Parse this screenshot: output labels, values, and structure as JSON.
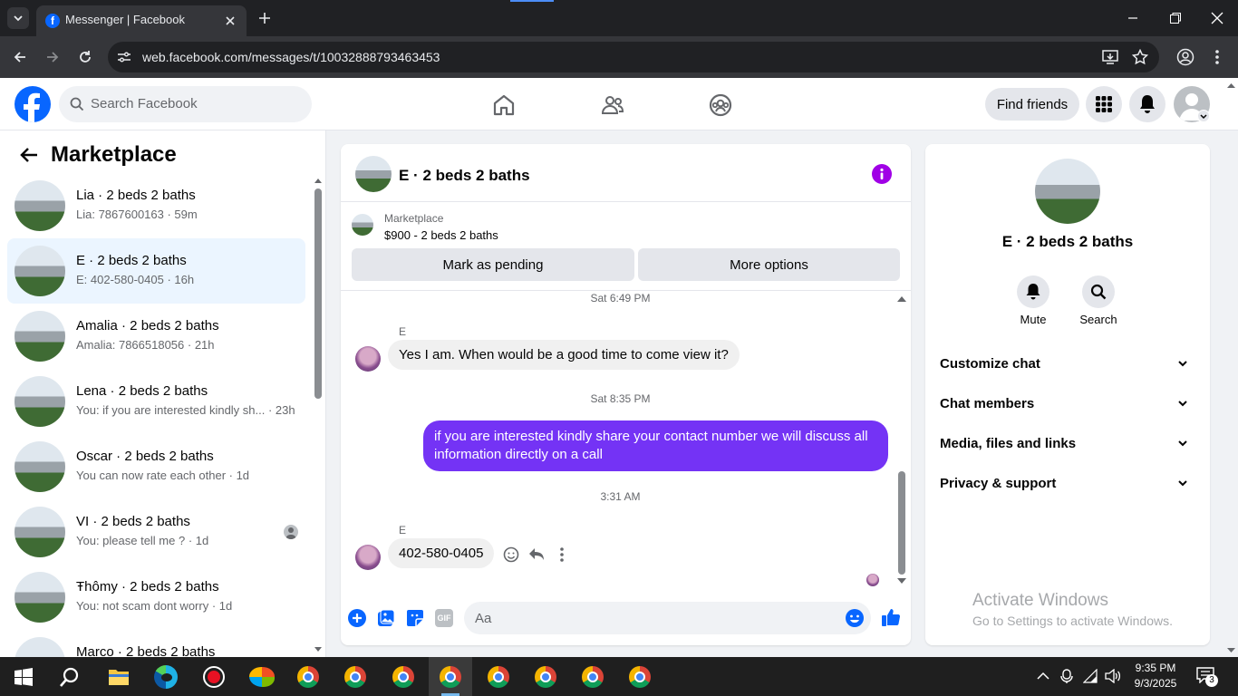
{
  "browser": {
    "tab_title": "Messenger | Facebook",
    "url": "web.facebook.com/messages/t/10032888793463453"
  },
  "fb": {
    "search_placeholder": "Search Facebook",
    "find_friends": "Find friends"
  },
  "left": {
    "title": "Marketplace",
    "conversations": [
      {
        "title": "Lia · 2 beds 2 baths",
        "sub": "Lia: 7867600163 · 59m"
      },
      {
        "title": "E · 2 beds 2 baths",
        "sub": "E: 402-580-0405 · 16h"
      },
      {
        "title": "Amalia · 2 beds 2 baths",
        "sub": "Amalia: 7866518056 · 21h"
      },
      {
        "title": "Lena · 2 beds 2 baths",
        "sub": "You: if you are interested kindly sh... · 23h"
      },
      {
        "title": "Oscar · 2 beds 2 baths",
        "sub": "You can now rate each other · 1d"
      },
      {
        "title": "VI · 2 beds 2 baths",
        "sub": "You: please tell me ? · 1d"
      },
      {
        "title": "Ŧhômy · 2 beds 2 baths",
        "sub": "You: not scam dont worry · 1d"
      },
      {
        "title": "Marco · 2 beds 2 baths",
        "sub": ""
      }
    ]
  },
  "chat": {
    "header_title": "E · 2 beds 2 baths",
    "listing_label": "Marketplace",
    "listing_price": "$900 - 2 beds 2 baths",
    "mark_pending": "Mark as pending",
    "more_options": "More options",
    "ts1": "Sat 6:49 PM",
    "sender1": "E",
    "msg1": "Yes I am. When would be a good time to come view it?",
    "ts2": "Sat 8:35 PM",
    "msg_out": "if you are interested kindly share your contact number we will discuss all information directly on a call",
    "ts3": "3:31 AM",
    "sender2": "E",
    "msg2": "402-580-0405",
    "composer_placeholder": "Aa",
    "gif_label": "GIF"
  },
  "right": {
    "title": "E · 2 beds 2 baths",
    "mute": "Mute",
    "search": "Search",
    "sections": [
      "Customize chat",
      "Chat members",
      "Media, files and links",
      "Privacy & support"
    ]
  },
  "watermark": {
    "line1": "Activate Windows",
    "line2": "Go to Settings to activate Windows."
  },
  "taskbar": {
    "time": "9:35 PM",
    "date": "9/3/2025",
    "notifications": "3"
  },
  "colors": {
    "fb_blue": "#0866ff",
    "messenger_purple": "#7433f5",
    "selected_row": "#ebf5ff"
  }
}
